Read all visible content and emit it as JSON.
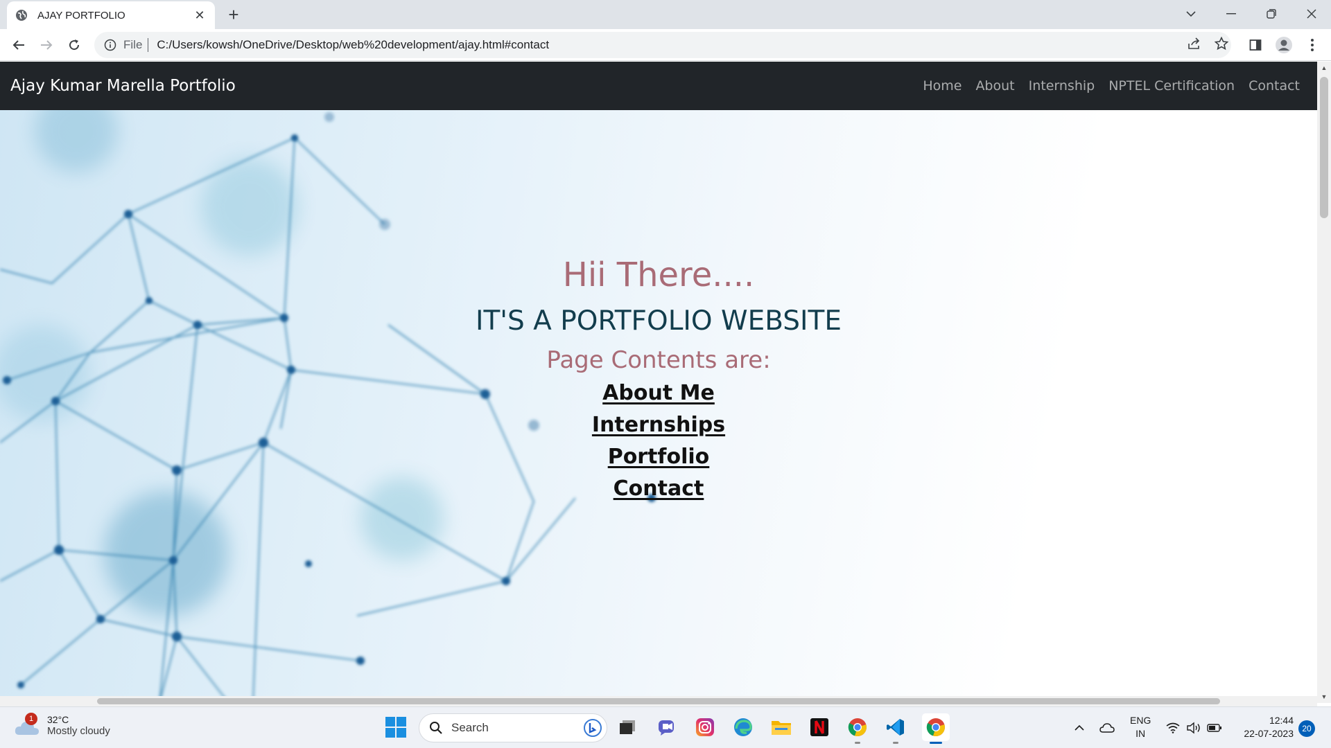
{
  "browser": {
    "tab_title": "AJAY PORTFOLIO",
    "url_scheme": "File",
    "url": "C:/Users/kowsh/OneDrive/Desktop/web%20development/ajay.html#contact"
  },
  "site": {
    "brand": "Ajay Kumar Marella Portfolio",
    "nav": [
      "Home",
      "About",
      "Internship",
      "NPTEL Certification",
      "Contact"
    ]
  },
  "hero": {
    "greeting": "Hii There....",
    "subtitle": "IT'S A PORTFOLIO WEBSITE",
    "contents_heading": "Page Contents are:",
    "links": [
      "About Me",
      "Internships",
      "Portfolio",
      "Contact"
    ]
  },
  "taskbar": {
    "weather_badge": "1",
    "weather_temp": "32°C",
    "weather_desc": "Mostly cloudy",
    "search_label": "Search",
    "lang_line1": "ENG",
    "lang_line2": "IN",
    "time": "12:44",
    "date": "22-07-2023",
    "notifications": "20",
    "apps": [
      "file-explorer-dark",
      "teams",
      "instagram",
      "edge",
      "file-explorer",
      "netflix",
      "chrome",
      "vscode",
      "chrome"
    ]
  },
  "colors": {
    "nav_bg": "#212529",
    "greeting": "#a96b76",
    "subtitle": "#123d4d",
    "accent_blue": "#005fb8"
  }
}
